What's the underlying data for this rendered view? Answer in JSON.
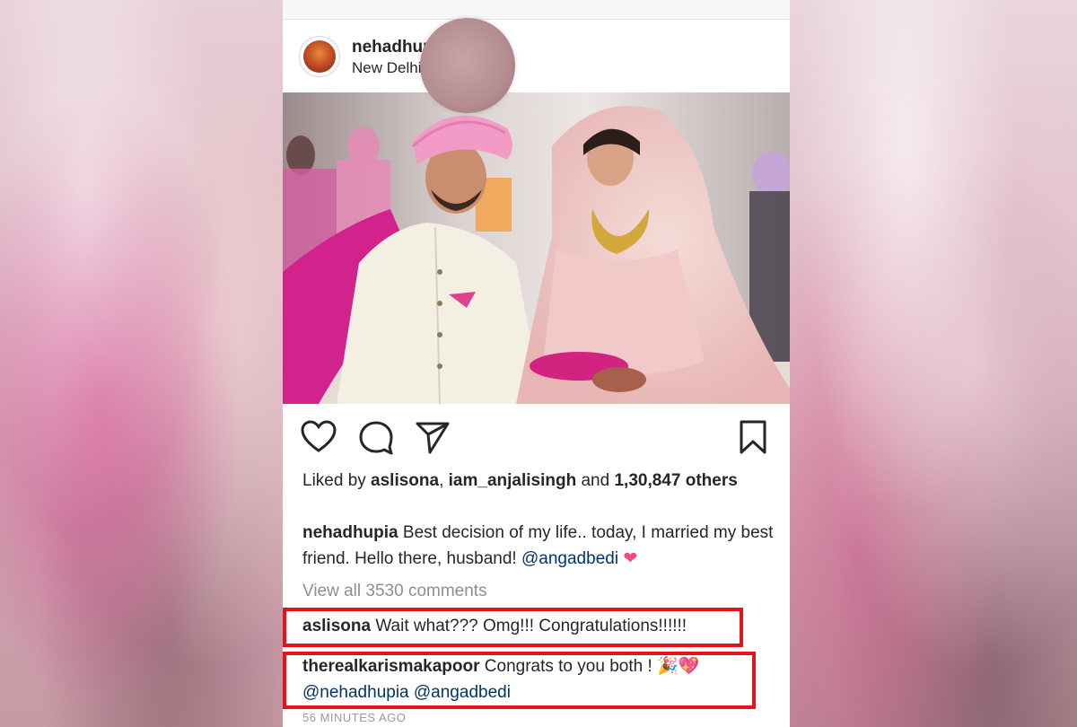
{
  "post": {
    "username": "nehadhupia",
    "location": "New Delhi"
  },
  "likes": {
    "prefix": "Liked by ",
    "user1": "aslisona",
    "sep": ", ",
    "user2": "iam_anjalisingh",
    "and": " and ",
    "count": "1,30,847 others"
  },
  "caption": {
    "username": "nehadhupia",
    "text": " Best decision of my life.. today, I married my best friend. Hello there, husband! ",
    "mention": "@angadbedi",
    "emoji": "❤"
  },
  "view_all_comments": "View all 3530 comments",
  "comments": [
    {
      "username": "aslisona",
      "text": " Wait what??? Omg!!! Congratulations!!!!!!"
    },
    {
      "username": "therealkarismakapoor",
      "text": " Congrats to you both ! ",
      "emoji": "🎉💖",
      "mentions": "@nehadhupia @angadbedi"
    }
  ],
  "timestamp": "56 MINUTES AGO",
  "icons": [
    "heart-icon",
    "comment-icon",
    "share-icon",
    "bookmark-icon"
  ],
  "colors": {
    "highlight": "#e3141c",
    "mention": "#003569",
    "heart": "#ed4b82"
  }
}
